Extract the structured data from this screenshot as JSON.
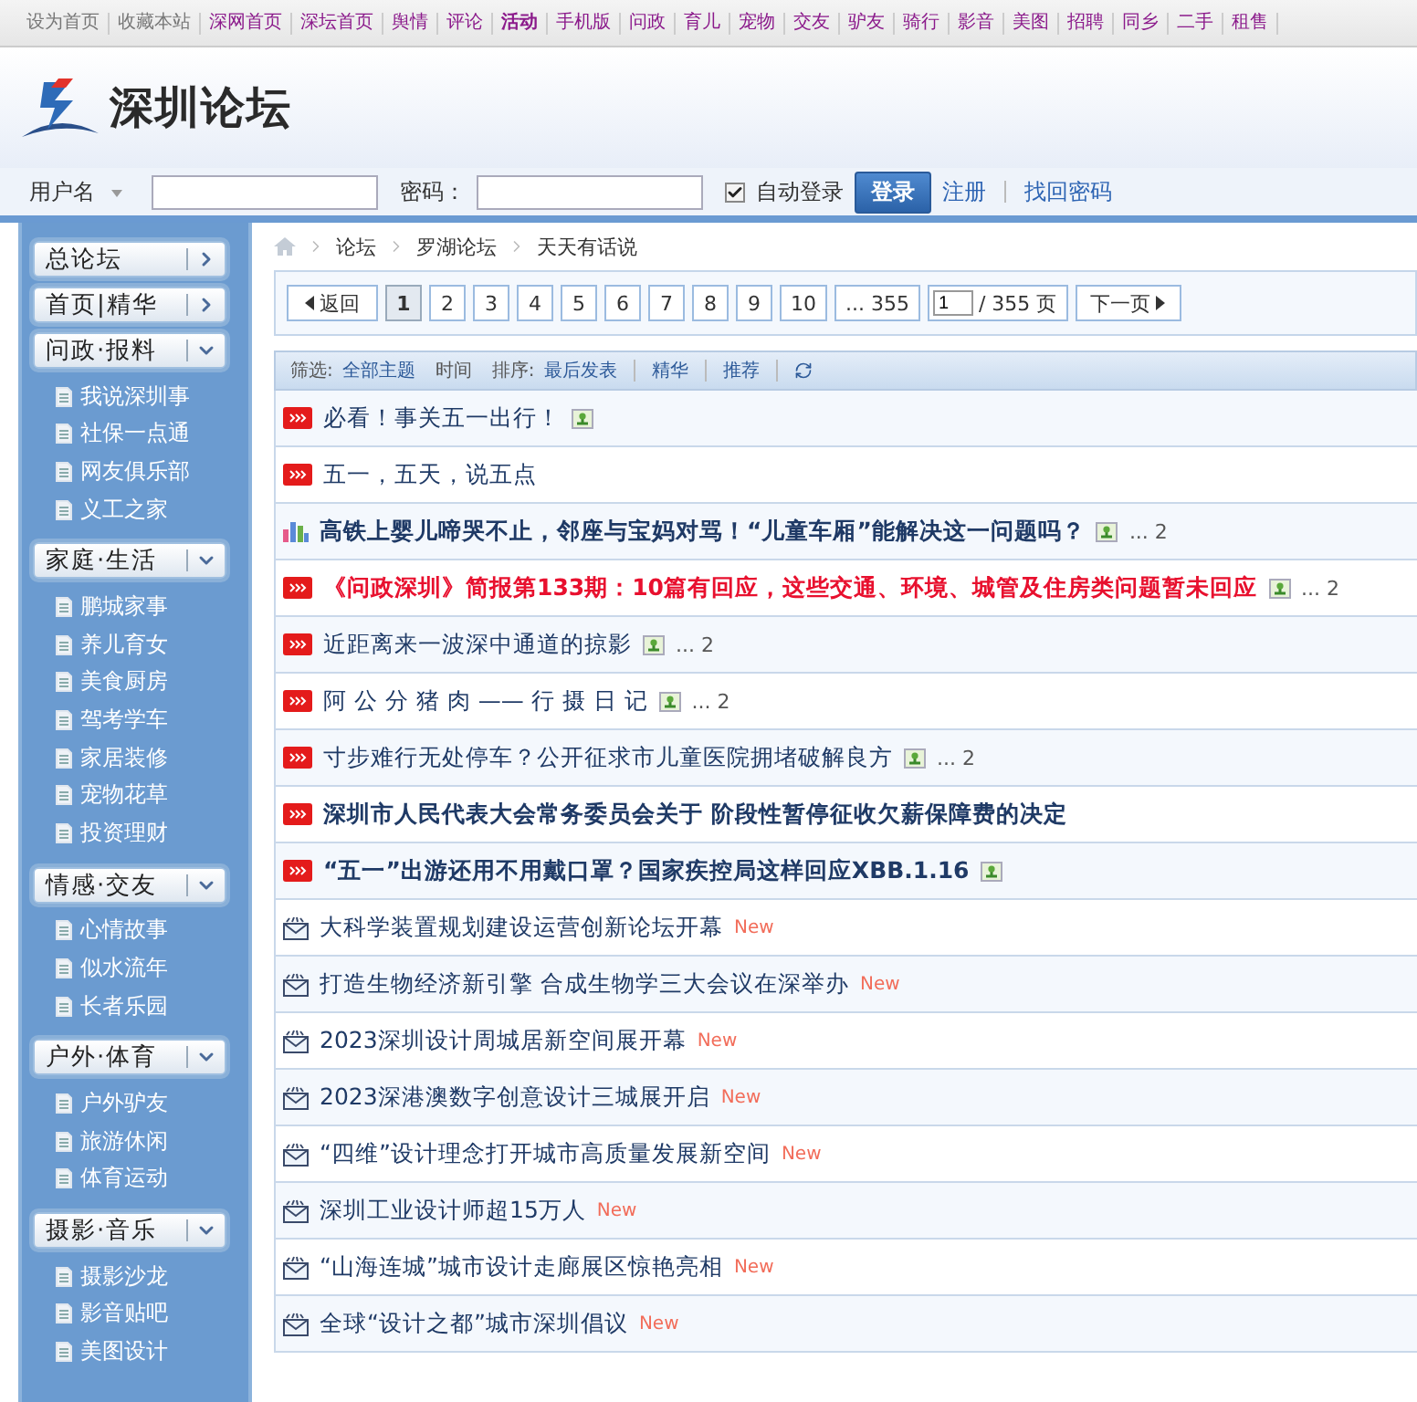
{
  "top_nav": [
    {
      "label": "设为首页",
      "kind": "utility",
      "bold": false
    },
    {
      "label": "收藏本站",
      "kind": "utility",
      "bold": false
    },
    {
      "label": "深网首页",
      "kind": "channel",
      "bold": false
    },
    {
      "label": "深坛首页",
      "kind": "channel",
      "bold": false
    },
    {
      "label": "舆情",
      "kind": "channel",
      "bold": false
    },
    {
      "label": "评论",
      "kind": "channel",
      "bold": false
    },
    {
      "label": "活动",
      "kind": "channel",
      "bold": true
    },
    {
      "label": "手机版",
      "kind": "channel",
      "bold": false
    },
    {
      "label": "问政",
      "kind": "channel",
      "bold": false
    },
    {
      "label": "育儿",
      "kind": "channel",
      "bold": false
    },
    {
      "label": "宠物",
      "kind": "channel",
      "bold": false
    },
    {
      "label": "交友",
      "kind": "channel",
      "bold": false
    },
    {
      "label": "驴友",
      "kind": "channel",
      "bold": false
    },
    {
      "label": "骑行",
      "kind": "channel",
      "bold": false
    },
    {
      "label": "影音",
      "kind": "channel",
      "bold": false
    },
    {
      "label": "美图",
      "kind": "channel",
      "bold": false
    },
    {
      "label": "招聘",
      "kind": "channel",
      "bold": false
    },
    {
      "label": "同乡",
      "kind": "channel",
      "bold": false
    },
    {
      "label": "二手",
      "kind": "channel",
      "bold": false
    },
    {
      "label": "租售",
      "kind": "channel",
      "bold": false
    }
  ],
  "logo": {
    "text": "深圳论坛"
  },
  "login": {
    "username_label": "用户名",
    "password_label": "密码：",
    "auto_login": {
      "label": "自动登录",
      "checked": true
    },
    "submit": "登录",
    "register": "注册",
    "recover": "找回密码"
  },
  "sidebar": [
    {
      "title": "总论坛",
      "kind": "link"
    },
    {
      "title": "首页|精华",
      "kind": "link"
    },
    {
      "title": "问政·报料",
      "kind": "folder",
      "children": [
        "我说深圳事",
        "社保一点通",
        "网友俱乐部",
        "义工之家"
      ]
    },
    {
      "title": "家庭·生活",
      "kind": "folder",
      "children": [
        "鹏城家事",
        "养儿育女",
        "美食厨房",
        "驾考学车",
        "家居装修",
        "宠物花草",
        "投资理财"
      ]
    },
    {
      "title": "情感·交友",
      "kind": "folder",
      "children": [
        "心情故事",
        "似水流年",
        "长者乐园"
      ]
    },
    {
      "title": "户外·体育",
      "kind": "folder",
      "children": [
        "户外驴友",
        "旅游休闲",
        "体育运动"
      ]
    },
    {
      "title": "摄影·音乐",
      "kind": "folder",
      "children": [
        "摄影沙龙",
        "影音贴吧",
        "美图设计"
      ]
    }
  ],
  "breadcrumb": [
    "论坛",
    "罗湖论坛",
    "天天有话说"
  ],
  "pager": {
    "back": "返回",
    "pages": [
      {
        "label": "1",
        "selected": true
      },
      {
        "label": "2",
        "selected": false
      },
      {
        "label": "3",
        "selected": false
      },
      {
        "label": "4",
        "selected": false
      },
      {
        "label": "5",
        "selected": false
      },
      {
        "label": "6",
        "selected": false
      },
      {
        "label": "7",
        "selected": false
      },
      {
        "label": "8",
        "selected": false
      },
      {
        "label": "9",
        "selected": false
      },
      {
        "label": "10",
        "selected": false
      },
      {
        "label": "... 355",
        "selected": false
      }
    ],
    "page_input": "1",
    "total": "/ 355 页",
    "next": "下一页"
  },
  "filter_bar": {
    "filter_label": "筛选:",
    "filter_value": "全部主题",
    "time": "时间",
    "sort_label": "排序:",
    "sort_value": "最后发表",
    "digest": "精华",
    "recommend": "推荐"
  },
  "threads": [
    {
      "kind": "hot",
      "bold": false,
      "color": "#1f3a66",
      "title": "必看！事关五一出行！",
      "image": true
    },
    {
      "kind": "hot",
      "bold": false,
      "color": "#1f3a66",
      "title": "五一，五天，说五点",
      "image": false
    },
    {
      "kind": "poll",
      "bold": true,
      "color": "#1f3a66",
      "title": "高铁上婴儿啼哭不止，邻座与宝妈对骂！“儿童车厢”能解决这一问题吗？",
      "image": true,
      "pages": "... 2"
    },
    {
      "kind": "hot",
      "bold": true,
      "color": "#e8102e",
      "title": "《问政深圳》简报第133期：10篇有回应，这些交通、环境、城管及住房类问题暂未回应",
      "image": true,
      "pages": "... 2"
    },
    {
      "kind": "hot",
      "bold": false,
      "color": "#1f3a66",
      "title": "近距离来一波深中通道的掠影",
      "image": true,
      "pages": "... 2"
    },
    {
      "kind": "hot",
      "bold": false,
      "color": "#1f3a66",
      "title": "阿 公 分 猪 肉 —— 行 摄 日 记",
      "image": true,
      "pages": "... 2"
    },
    {
      "kind": "hot",
      "bold": false,
      "color": "#1f3a66",
      "title": "寸步难行无处停车？公开征求市儿童医院拥堵破解良方",
      "image": true,
      "pages": "... 2"
    },
    {
      "kind": "hot",
      "bold": true,
      "color": "#1f3a66",
      "title": "深圳市人民代表大会常务委员会关于 阶段性暂停征收欠薪保障费的决定",
      "image": false
    },
    {
      "kind": "hot",
      "bold": true,
      "color": "#1f3a66",
      "title": "“五一”出游还用不用戴口罩？国家疾控局这样回应XBB.1.16",
      "image": true
    },
    {
      "kind": "new",
      "bold": false,
      "color": "#1f3a66",
      "title": "大科学装置规划建设运营创新论坛开幕",
      "image": false,
      "badge": "New"
    },
    {
      "kind": "new",
      "bold": false,
      "color": "#1f3a66",
      "title": "打造生物经济新引擎 合成生物学三大会议在深举办",
      "image": false,
      "badge": "New"
    },
    {
      "kind": "new",
      "bold": false,
      "color": "#1f3a66",
      "title": "2023深圳设计周城居新空间展开幕",
      "image": false,
      "badge": "New"
    },
    {
      "kind": "new",
      "bold": false,
      "color": "#1f3a66",
      "title": "2023深港澳数字创意设计三城展开启",
      "image": false,
      "badge": "New"
    },
    {
      "kind": "new",
      "bold": false,
      "color": "#1f3a66",
      "title": "“四维”设计理念打开城市高质量发展新空间",
      "image": false,
      "badge": "New"
    },
    {
      "kind": "new",
      "bold": false,
      "color": "#1f3a66",
      "title": "深圳工业设计师超15万人",
      "image": false,
      "badge": "New"
    },
    {
      "kind": "new",
      "bold": false,
      "color": "#1f3a66",
      "title": "“山海连城”城市设计走廊展区惊艳亮相",
      "image": false,
      "badge": "New"
    },
    {
      "kind": "new",
      "bold": false,
      "color": "#1f3a66",
      "title": "全球“设计之都”城市深圳倡议",
      "image": false,
      "badge": "New"
    }
  ]
}
